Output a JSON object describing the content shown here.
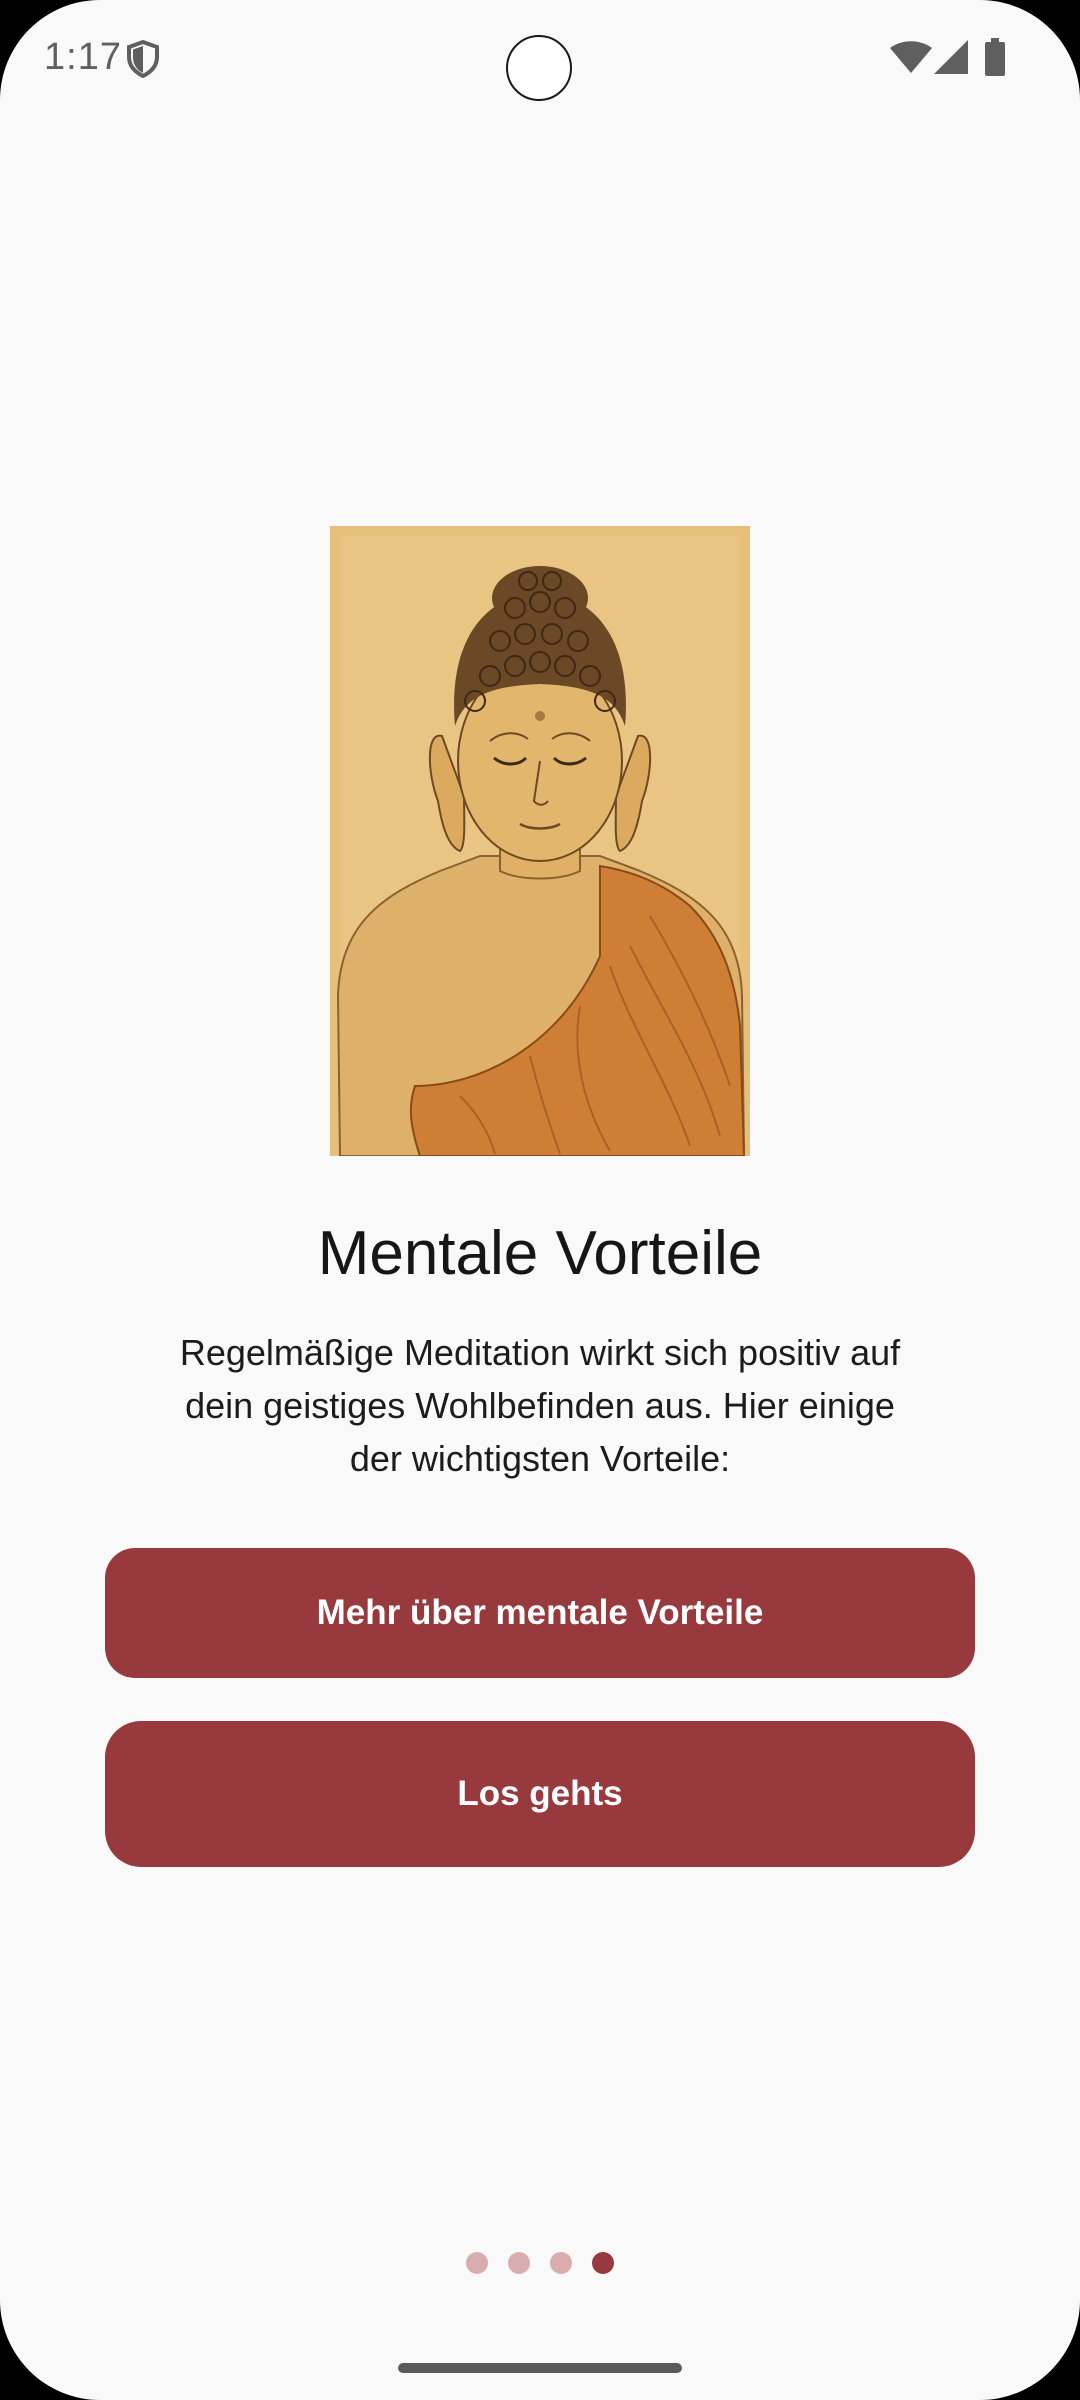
{
  "status_bar": {
    "time": "1:17",
    "icons": [
      "shield-icon",
      "wifi-icon",
      "cellular-signal-icon",
      "battery-icon"
    ]
  },
  "onboarding": {
    "image": "buddha-illustration",
    "title": "Mentale Vorteile",
    "description": "Regelmäßige Meditation wirkt sich positiv auf dein geistiges Wohlbefinden aus. Hier einige der wichtigsten Vorteile:",
    "more_button_label": "Mehr über mentale Vorteile",
    "start_button_label": "Los gehts"
  },
  "pager": {
    "total_pages": 4,
    "current_page": 4
  },
  "colors": {
    "accent": "#983a3d",
    "dot_inactive": "#d9adad",
    "background": "#f9f9f9",
    "title_text": "#161616"
  }
}
